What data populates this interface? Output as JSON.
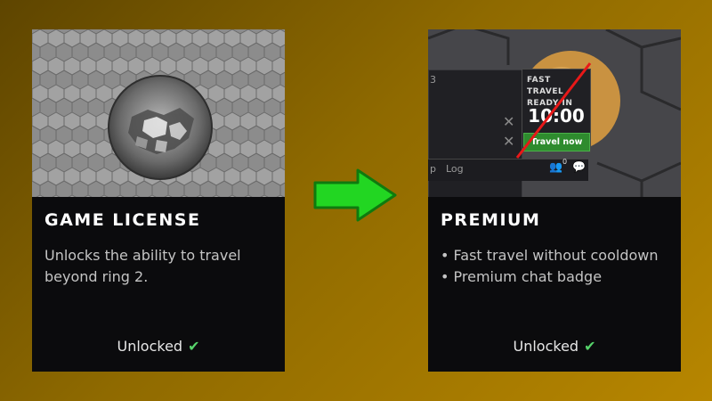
{
  "cards": {
    "game_license": {
      "title": "GAME LICENSE",
      "description": "Unlocks the ability to travel beyond ring 2.",
      "status": "Unlocked"
    },
    "premium": {
      "title": "PREMIUM",
      "bullets": [
        "Fast travel without cooldown",
        "Premium chat badge"
      ],
      "status": "Unlocked",
      "preview": {
        "fast_travel_label": "FAST TRAVEL READY IN",
        "timer": "10:00",
        "travel_button": "Travel now",
        "tab_fragment_1": "3",
        "tab_fragment_2": "p",
        "tab_log": "Log",
        "notification_count": "0"
      }
    }
  },
  "icons": {
    "status_check": "check-icon",
    "transition_arrow": "arrow-right-icon",
    "close": "close-icon",
    "players": "players-icon",
    "chat": "chat-icon"
  },
  "colors": {
    "background_start": "#5e4500",
    "background_end": "#b78600",
    "card_background": "#0b0b0d",
    "check_green": "#56d36a",
    "arrow_green": "#22d622",
    "travel_button_green": "#2e8b2e",
    "highlight_orange": "#e0a040"
  }
}
